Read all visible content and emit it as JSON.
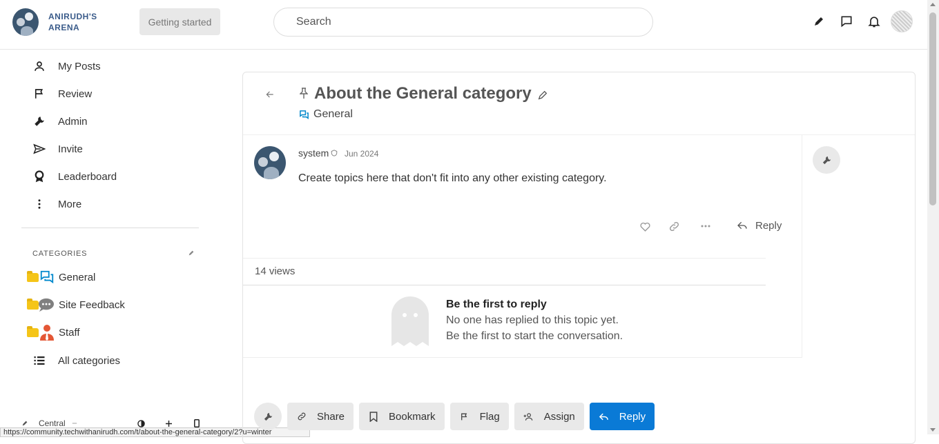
{
  "header": {
    "logo_text_line1": "ANIRUDH'S",
    "logo_text_line2": "ARENA",
    "getting_started": "Getting started",
    "search_placeholder": "Search",
    "icons": [
      "pencil-icon",
      "chat-icon",
      "bell-icon",
      "user-avatar"
    ]
  },
  "sidebar": {
    "items": [
      {
        "label": "My Posts",
        "icon": "user-icon"
      },
      {
        "label": "Review",
        "icon": "flag-icon"
      },
      {
        "label": "Admin",
        "icon": "wrench-icon"
      },
      {
        "label": "Invite",
        "icon": "send-icon"
      },
      {
        "label": "Leaderboard",
        "icon": "award-icon"
      },
      {
        "label": "More",
        "icon": "more-vertical-icon"
      }
    ],
    "categories_title": "CATEGORIES",
    "categories": [
      {
        "label": "General"
      },
      {
        "label": "Site Feedback"
      },
      {
        "label": "Staff"
      }
    ],
    "all_categories": "All categories",
    "footer_theme": "Central"
  },
  "status_url": "https://community.techwithanirudh.com/t/about-the-general-category/2?u=winter",
  "topic": {
    "title": "About the General category",
    "category": "General",
    "post": {
      "username": "system",
      "date": "Jun 2024",
      "body": "Create topics here that don't fit into any other existing category.",
      "reply_label": "Reply"
    },
    "views": "14 views",
    "empty": {
      "title": "Be the first to reply",
      "line1": "No one has replied to this topic yet.",
      "line2": "Be the first to start the conversation."
    },
    "footer_buttons": {
      "share": "Share",
      "bookmark": "Bookmark",
      "flag": "Flag",
      "assign": "Assign",
      "reply": "Reply"
    }
  },
  "colors": {
    "primary": "#0a7ad6",
    "category_general": "#0088cc",
    "folder": "#f5c518",
    "staff_red": "#e45735"
  }
}
